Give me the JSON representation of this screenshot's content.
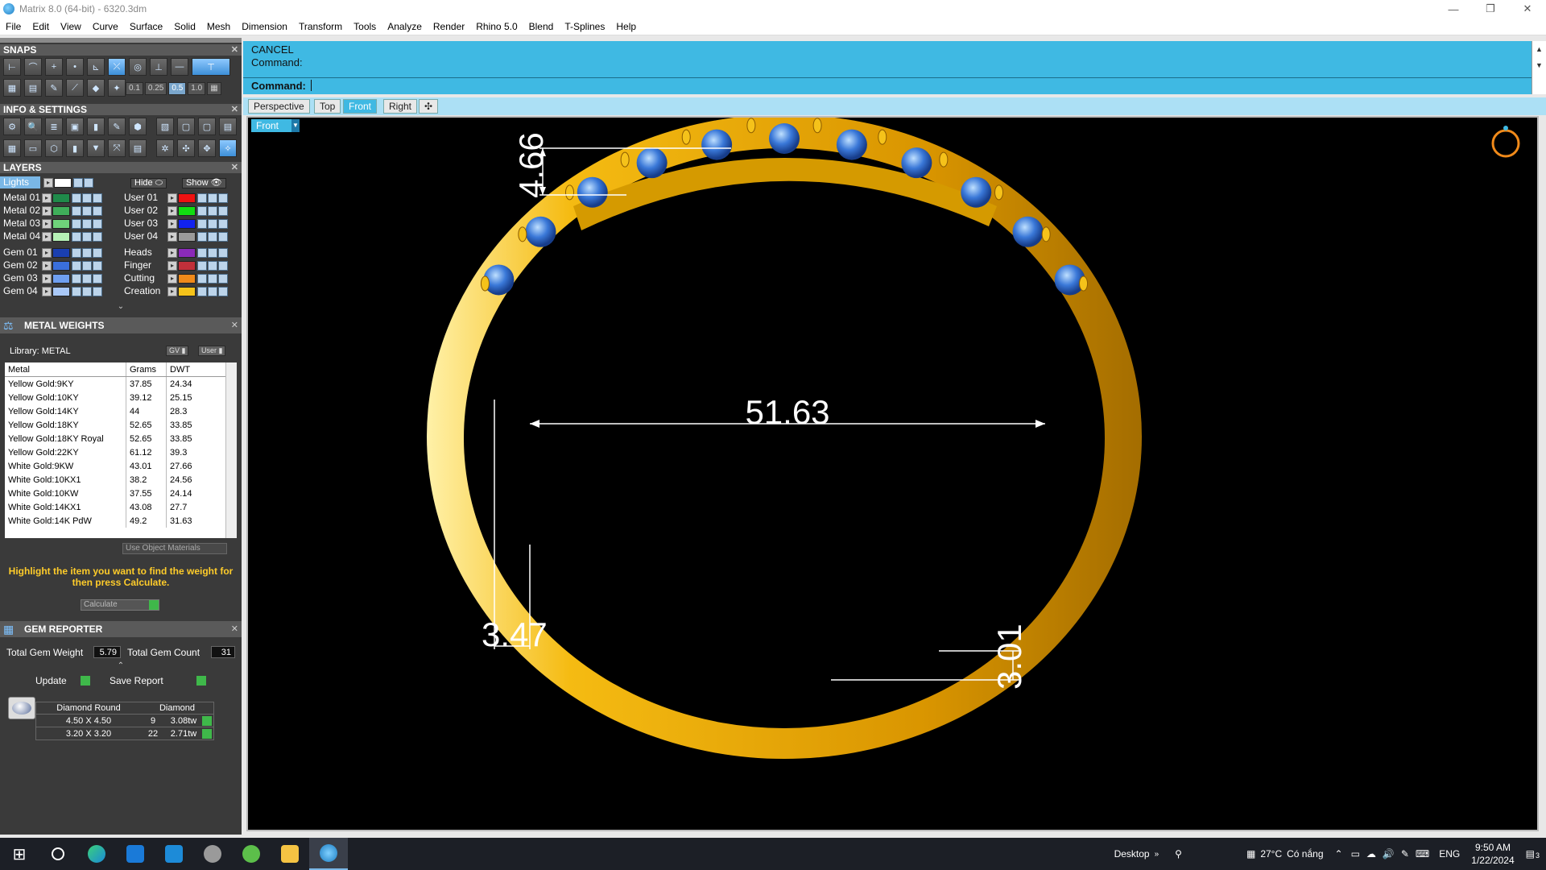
{
  "window": {
    "title": "Matrix 8.0 (64-bit) - 6320.3dm",
    "minimize": "—",
    "restore": "❐",
    "close": "✕"
  },
  "menu": [
    "File",
    "Edit",
    "View",
    "Curve",
    "Surface",
    "Solid",
    "Mesh",
    "Dimension",
    "Transform",
    "Tools",
    "Analyze",
    "Render",
    "Rhino 5.0",
    "Blend",
    "T-Splines",
    "Help"
  ],
  "snaps": {
    "title": "SNAPS",
    "values": [
      "0.1",
      "0.25",
      "0.5",
      "1.0"
    ]
  },
  "info_settings": {
    "title": "INFO & SETTINGS"
  },
  "layers": {
    "title": "LAYERS",
    "lights": "Lights",
    "hide": "Hide",
    "show": "Show",
    "left": [
      {
        "name": "Metal 01",
        "color": "#1f8a4a"
      },
      {
        "name": "Metal 02",
        "color": "#3fae5a"
      },
      {
        "name": "Metal 03",
        "color": "#6fd37a"
      },
      {
        "name": "Metal 04",
        "color": "#b5f0b5"
      },
      {
        "name": "Gem 01",
        "color": "#1a3fb0"
      },
      {
        "name": "Gem 02",
        "color": "#3a6fdc"
      },
      {
        "name": "Gem 03",
        "color": "#6f9ff0"
      },
      {
        "name": "Gem 04",
        "color": "#a9c8f7"
      }
    ],
    "right": [
      {
        "name": "User 01",
        "color": "#ee1111"
      },
      {
        "name": "User 02",
        "color": "#11dd11"
      },
      {
        "name": "User 03",
        "color": "#1122ee"
      },
      {
        "name": "User 04",
        "color": "#9a9a9a"
      },
      {
        "name": "Heads",
        "color": "#8a2ab8"
      },
      {
        "name": "Finger",
        "color": "#c0303a"
      },
      {
        "name": "Cutting",
        "color": "#f08a1a"
      },
      {
        "name": "Creation",
        "color": "#f5c31a"
      }
    ]
  },
  "metal_weights": {
    "title": "METAL WEIGHTS",
    "library": "Library: METAL",
    "gv": "GV",
    "user": "User",
    "columns": [
      "Metal",
      "Grams",
      "DWT"
    ],
    "rows": [
      [
        "Yellow Gold:9KY",
        "37.85",
        "24.34"
      ],
      [
        "Yellow Gold:10KY",
        "39.12",
        "25.15"
      ],
      [
        "Yellow Gold:14KY",
        "44",
        "28.3"
      ],
      [
        "Yellow Gold:18KY",
        "52.65",
        "33.85"
      ],
      [
        "Yellow Gold:18KY Royal",
        "52.65",
        "33.85"
      ],
      [
        "Yellow Gold:22KY",
        "61.12",
        "39.3"
      ],
      [
        "White Gold:9KW",
        "43.01",
        "27.66"
      ],
      [
        "White Gold:10KX1",
        "38.2",
        "24.56"
      ],
      [
        "White Gold:10KW",
        "37.55",
        "24.14"
      ],
      [
        "White Gold:14KX1",
        "43.08",
        "27.7"
      ],
      [
        "White Gold:14K PdW",
        "49.2",
        "31.63"
      ]
    ],
    "use_object_materials": "Use Object Materials",
    "hint": "Highlight the item you want to find the weight for then press Calculate.",
    "calculate": "Calculate"
  },
  "gem_reporter": {
    "title": "GEM REPORTER",
    "total_weight_label": "Total Gem Weight",
    "total_weight": "5.79",
    "total_count_label": "Total Gem Count",
    "total_count": "31",
    "update": "Update",
    "save_report": "Save Report",
    "head": [
      "Diamond Round",
      "Diamond"
    ],
    "rows": [
      [
        "4.50 X 4.50",
        "9",
        "3.08tw"
      ],
      [
        "3.20 X 3.20",
        "22",
        "2.71tw"
      ]
    ]
  },
  "command": {
    "history": [
      "CANCEL",
      "Command:"
    ],
    "prompt": "Command:",
    "value": ""
  },
  "viewports": {
    "tabs": [
      "Perspective",
      "Top",
      "Front",
      "Right"
    ],
    "active": "Front",
    "current": "Front"
  },
  "dimensions": {
    "top_height": "4.66",
    "inner_diameter": "51.63",
    "band_width": "3.47",
    "bottom_thickness": "3.01"
  },
  "colors": {
    "command_bg": "#3fb9e3",
    "gold": "#f2b600",
    "gem": "#3a78d8",
    "hint": "#ffcc2a"
  },
  "taskbar": {
    "desktop": "Desktop",
    "weather": "27°C",
    "weather_text": "Có nắng",
    "lang": "ENG",
    "time": "9:50 AM",
    "date": "1/22/2024",
    "notifications": "3"
  }
}
